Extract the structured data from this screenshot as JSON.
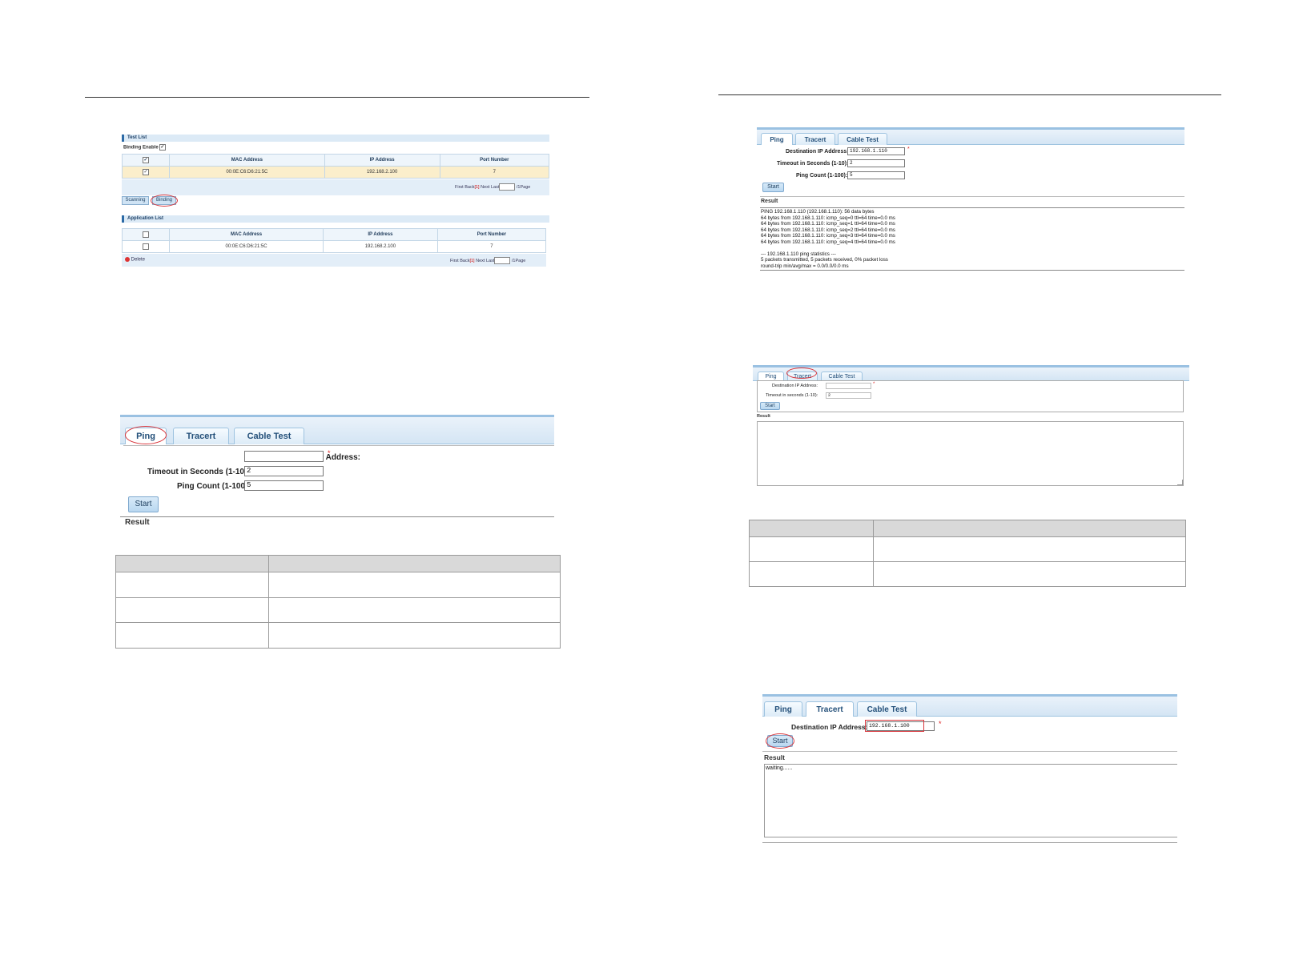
{
  "binding_ui": {
    "test_list_title": "Test List",
    "binding_enable_label": "Binding Enable",
    "columns": [
      "MAC Address",
      "IP Address",
      "Port Number"
    ],
    "test_rows": [
      {
        "mac": "00:0E:C6:D6:21:5C",
        "ip": "192.168.2.100",
        "port": "7"
      }
    ],
    "pager": {
      "first": "First",
      "back": "Back",
      "current": "[1]",
      "next": "Next",
      "last": "Last",
      "pages": "/1Page"
    },
    "scanning_button": "Scanning",
    "binding_button": "Binding",
    "application_list_title": "Application List",
    "app_rows": [
      {
        "mac": "00:0E:C6:D6:21:5C",
        "ip": "192.168.2.100",
        "port": "7"
      }
    ],
    "delete_button": "Delete"
  },
  "ping_large": {
    "tabs": [
      "Ping",
      "Tracert",
      "Cable Test"
    ],
    "dest_label": "Destination IP Address:",
    "dest_value": "",
    "timeout_label": "Timeout in Seconds (1-10):",
    "timeout_value": "2",
    "count_label": "Ping Count (1-100):",
    "count_value": "5",
    "start_button": "Start",
    "result_label": "Result",
    "required_mark": "*"
  },
  "ping_result": {
    "tabs": [
      "Ping",
      "Tracert",
      "Cable Test"
    ],
    "dest_label": "Destination IP Address:",
    "dest_value": "192.168.1.110",
    "timeout_label": "Timeout in Seconds (1-10):",
    "timeout_value": "2",
    "count_label": "Ping Count (1-100):",
    "count_value": "5",
    "start_button": "Start",
    "result_label": "Result",
    "required_mark": "*",
    "output": "PING 192.168.1.110 (192.168.1.110): 56 data bytes\n64 bytes from 192.168.1.110: icmp_seq=0 ttl=64 time=0.0 ms\n64 bytes from 192.168.1.110: icmp_seq=1 ttl=64 time=0.0 ms\n64 bytes from 192.168.1.110: icmp_seq=2 ttl=64 time=0.0 ms\n64 bytes from 192.168.1.110: icmp_seq=3 ttl=64 time=0.0 ms\n64 bytes from 192.168.1.110: icmp_seq=4 ttl=64 time=0.0 ms\n\n--- 192.168.1.110 ping statistics ---\n5 packets transmitted, 5 packets received, 0% packet loss\nround-trip min/avg/max = 0.0/0.0/0.0 ms"
  },
  "tracert_small": {
    "tabs": [
      "Ping",
      "Tracert",
      "Cable Test"
    ],
    "dest_label": "Destination IP Address:",
    "dest_value": "",
    "timeout_label": "Timeout in seconds (1-10):",
    "timeout_value": "2",
    "start_button": "Start",
    "result_label": "Result",
    "required_mark": "*"
  },
  "tracert_result": {
    "tabs": [
      "Ping",
      "Tracert",
      "Cable Test"
    ],
    "dest_label": "Destination IP Address:",
    "dest_value": "192.168.1.100",
    "start_button": "Start",
    "result_label": "Result",
    "required_mark": "*",
    "output": "waiting......"
  },
  "colors": {
    "highlight": "#d8363c",
    "tab_text": "#24507a",
    "table_header": "#d9d9d9"
  }
}
